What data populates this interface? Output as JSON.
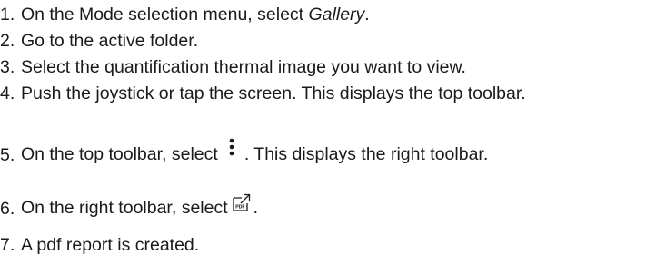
{
  "steps": [
    {
      "num": "1.",
      "before": "On the Mode selection menu, select ",
      "emph": "Gallery",
      "after": "."
    },
    {
      "num": "2.",
      "text": "Go to the active folder."
    },
    {
      "num": "3.",
      "text": "Select the quantification thermal image you want to view."
    },
    {
      "num": "4.",
      "text": "Push the joystick or tap the screen. This displays the top toolbar."
    },
    {
      "num": "5.",
      "before": "On the top toolbar, select",
      "icon": "more-vertical-icon",
      "after": ". This displays the right toolbar."
    },
    {
      "num": "6.",
      "before": "On the right toolbar, select",
      "icon": "pdf-export-icon",
      "icon_text": "PDF",
      "after": "."
    },
    {
      "num": "7.",
      "text": "A pdf report is created."
    }
  ]
}
